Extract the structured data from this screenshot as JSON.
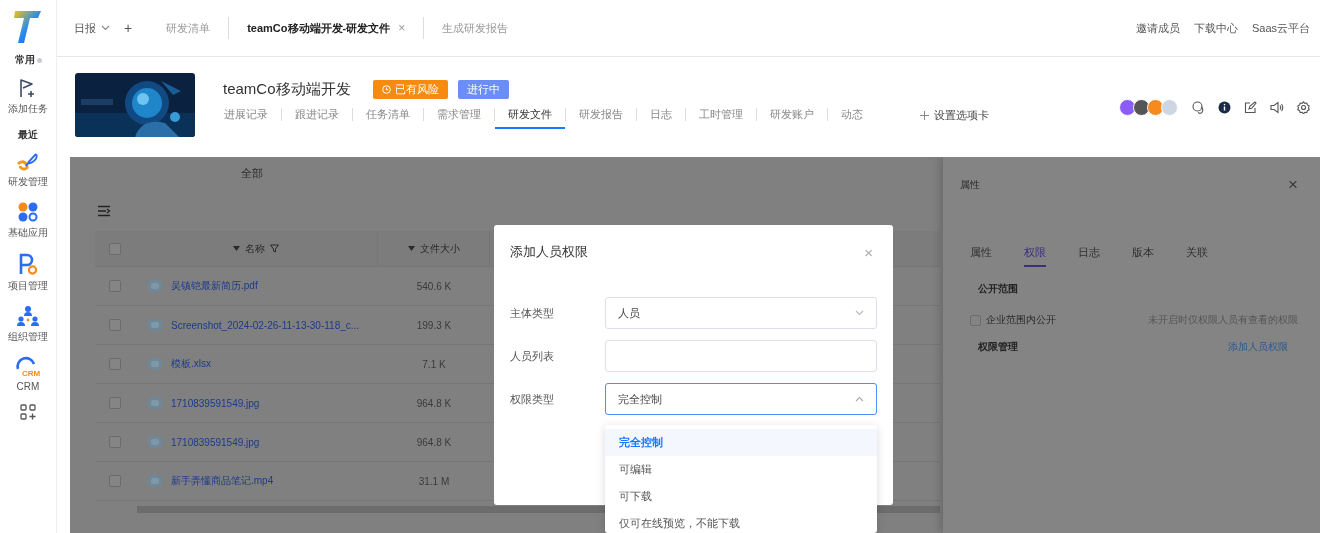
{
  "sidebar": {
    "items": [
      {
        "kind": "logo"
      },
      {
        "kind": "heading",
        "label": "常用",
        "indicator": true
      },
      {
        "kind": "app",
        "label": "添加任务"
      },
      {
        "kind": "heading",
        "label": "最近",
        "indicator": false
      },
      {
        "kind": "app",
        "label": "研发管理"
      },
      {
        "kind": "app",
        "label": "基础应用"
      },
      {
        "kind": "app",
        "label": "项目管理"
      },
      {
        "kind": "app",
        "label": "组织管理"
      },
      {
        "kind": "app",
        "label": "CRM",
        "icon_text": "CRM"
      },
      {
        "kind": "more"
      }
    ]
  },
  "topbar": {
    "menu": "日报",
    "add": "+",
    "tabs": [
      {
        "label": "研发清单",
        "selected": false
      },
      {
        "label": "teamCo移动端开发-研发文件",
        "selected": true,
        "close": "×"
      },
      {
        "label": "生成研发报告",
        "selected": false
      }
    ],
    "links": [
      "邀请成员",
      "下载中心",
      "Saas云平台"
    ]
  },
  "project": {
    "title": "teamCo移动端开发",
    "badges": [
      {
        "kind": "risk",
        "label": "已有风险",
        "color": "#f78b0f"
      },
      {
        "kind": "status",
        "label": "进行中",
        "color": "#6b8ef6"
      }
    ],
    "tabs": [
      {
        "label": "进展记录",
        "selected": false
      },
      {
        "label": "跟进记录",
        "selected": false
      },
      {
        "label": "任务清单",
        "selected": false
      },
      {
        "label": "需求管理",
        "selected": false
      },
      {
        "label": "研发文件",
        "selected": true
      },
      {
        "label": "研发报告",
        "selected": false
      },
      {
        "label": "日志",
        "selected": false
      },
      {
        "label": "工时管理",
        "selected": false
      },
      {
        "label": "研发账户",
        "selected": false
      },
      {
        "label": "动态",
        "selected": false
      }
    ],
    "add_tab": "设置选项卡"
  },
  "files": {
    "filter": "全部",
    "select_all": {
      "checked": false
    },
    "columns": [
      "名称",
      "文件大小"
    ],
    "rows": [
      {
        "name": "吴镇铠最新简历.pdf",
        "size": "540.6 K",
        "checked": false
      },
      {
        "name": "Screenshot_2024-02-26-11-13-30-118_c...",
        "size": "199.3 K",
        "checked": false
      },
      {
        "name": "模板.xlsx",
        "size": "7.1 K",
        "checked": false
      },
      {
        "name": "1710839591549.jpg",
        "size": "964.8 K",
        "checked": false
      },
      {
        "name": "1710839591549.jpg",
        "size": "964.8 K",
        "checked": false
      },
      {
        "name": "新手弄懂商品笔记.mp4",
        "size": "31.1 M",
        "checked": false
      }
    ]
  },
  "properties": {
    "title": "属性",
    "close": "×",
    "tabs": [
      {
        "label": "属性",
        "selected": false
      },
      {
        "label": "权限",
        "selected": true
      },
      {
        "label": "日志",
        "selected": false
      },
      {
        "label": "版本",
        "selected": false
      },
      {
        "label": "关联",
        "selected": false
      }
    ],
    "public_scope": {
      "heading": "公开范围",
      "label": "企业范围内公开",
      "checked": false,
      "hint": "未开启时仅权限人员有查看的权限"
    },
    "management": {
      "heading": "权限管理",
      "action": "添加人员权限"
    }
  },
  "dialog": {
    "title": "添加人员权限",
    "close": "×",
    "fields": [
      {
        "kind": "select",
        "label": "主体类型",
        "value": "人员",
        "expanded": false
      },
      {
        "kind": "input",
        "label": "人员列表"
      },
      {
        "kind": "select",
        "label": "权限类型",
        "value": "完全控制",
        "expanded": true
      }
    ],
    "options": [
      {
        "label": "完全控制",
        "selected": true
      },
      {
        "label": "可编辑",
        "selected": false
      },
      {
        "label": "可下载",
        "selected": false
      },
      {
        "label": "仅可在线预览，不能下载",
        "selected": false
      }
    ]
  }
}
